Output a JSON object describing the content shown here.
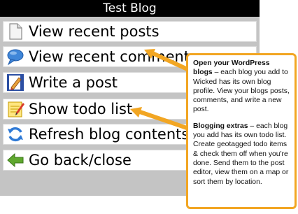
{
  "window": {
    "title": "Test Blog"
  },
  "menu": {
    "items": [
      {
        "icon": "document-icon",
        "label": "View recent posts"
      },
      {
        "icon": "speech-bubble-icon",
        "label": "View recent comments"
      },
      {
        "icon": "write-post-icon",
        "label": "Write a post"
      },
      {
        "icon": "todo-notepad-icon",
        "label": "Show todo list"
      },
      {
        "icon": "refresh-icon",
        "label": "Refresh blog contents"
      },
      {
        "icon": "back-arrow-icon",
        "label": "Go back/close"
      }
    ]
  },
  "callout": {
    "p1_bold": "Open your WordPress blogs",
    "p1_text": " – each blog you add to Wicked has its own blog profile. View your blogs posts, comments, and write a new post.",
    "p2_bold": "Blogging extras",
    "p2_text": " – each blog you add has its own todo list. Create geotagged todo items & check them off when you're done. Send them to the post editor, view them on a map or sort them by location."
  },
  "colors": {
    "callout_border": "#f2a623",
    "titlebar": "#000000",
    "screen_bg": "#c4c4c4"
  }
}
